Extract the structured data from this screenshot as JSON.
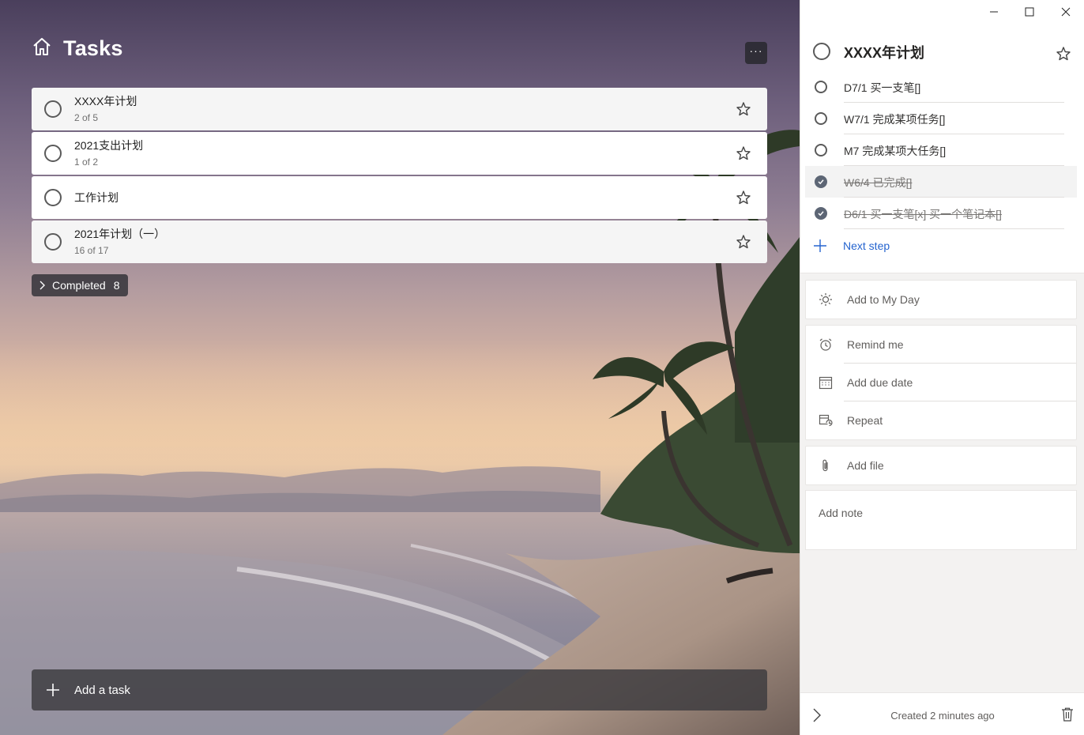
{
  "header": {
    "title": "Tasks",
    "home_icon": "home-icon",
    "more_label": "···"
  },
  "tasks": [
    {
      "name": "XXXX年计划",
      "progress": "2 of 5"
    },
    {
      "name": "2021支出计划",
      "progress": "1 of 2"
    },
    {
      "name": "工作计划",
      "progress": ""
    },
    {
      "name": "2021年计划（一）",
      "progress": "16 of 17"
    }
  ],
  "completed": {
    "label": "Completed",
    "count": "8"
  },
  "add_task": {
    "label": "Add a task"
  },
  "detail": {
    "title": "XXXX年计划",
    "steps": [
      {
        "text": "D7/1 买一支笔[]",
        "done": false
      },
      {
        "text": "W7/1 完成某项任务[]",
        "done": false
      },
      {
        "text": "M7 完成某项大任务[]",
        "done": false
      },
      {
        "text": "W6/4 已完成[]",
        "done": true
      },
      {
        "text": "D6/1 买一支笔[x] 买一个笔记本[]",
        "done": true
      }
    ],
    "next_step": "Next step",
    "my_day": "Add to My Day",
    "remind": "Remind me",
    "due": "Add due date",
    "repeat": "Repeat",
    "file": "Add file",
    "note": "Add note",
    "created": "Created 2 minutes ago"
  },
  "colors": {
    "accent": "#2564cf",
    "check_fill": "#5d6675"
  }
}
